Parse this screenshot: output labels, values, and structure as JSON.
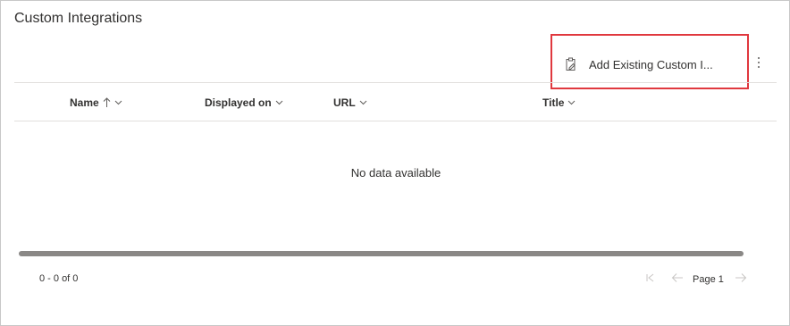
{
  "section": {
    "title": "Custom Integrations"
  },
  "command_bar": {
    "add_existing_label": "Add Existing Custom I...",
    "add_existing_icon": "clipboard-edit-icon",
    "more_icon": "more-vertical-icon",
    "highlight_color": "#e0383e"
  },
  "grid": {
    "columns": [
      {
        "label": "Name",
        "sort": "ascending",
        "icons": [
          "sort-up-arrow-icon",
          "chevron-down-icon"
        ]
      },
      {
        "label": "Displayed on",
        "icons": [
          "chevron-down-icon"
        ]
      },
      {
        "label": "URL",
        "icons": [
          "chevron-down-icon"
        ]
      },
      {
        "label": "Title",
        "icons": [
          "chevron-down-icon"
        ]
      }
    ],
    "empty_message": "No data available"
  },
  "footer": {
    "record_count": "0 - 0 of 0",
    "page_label": "Page 1",
    "pager_icons": [
      "first-page-icon",
      "previous-page-icon",
      "next-page-icon"
    ]
  }
}
